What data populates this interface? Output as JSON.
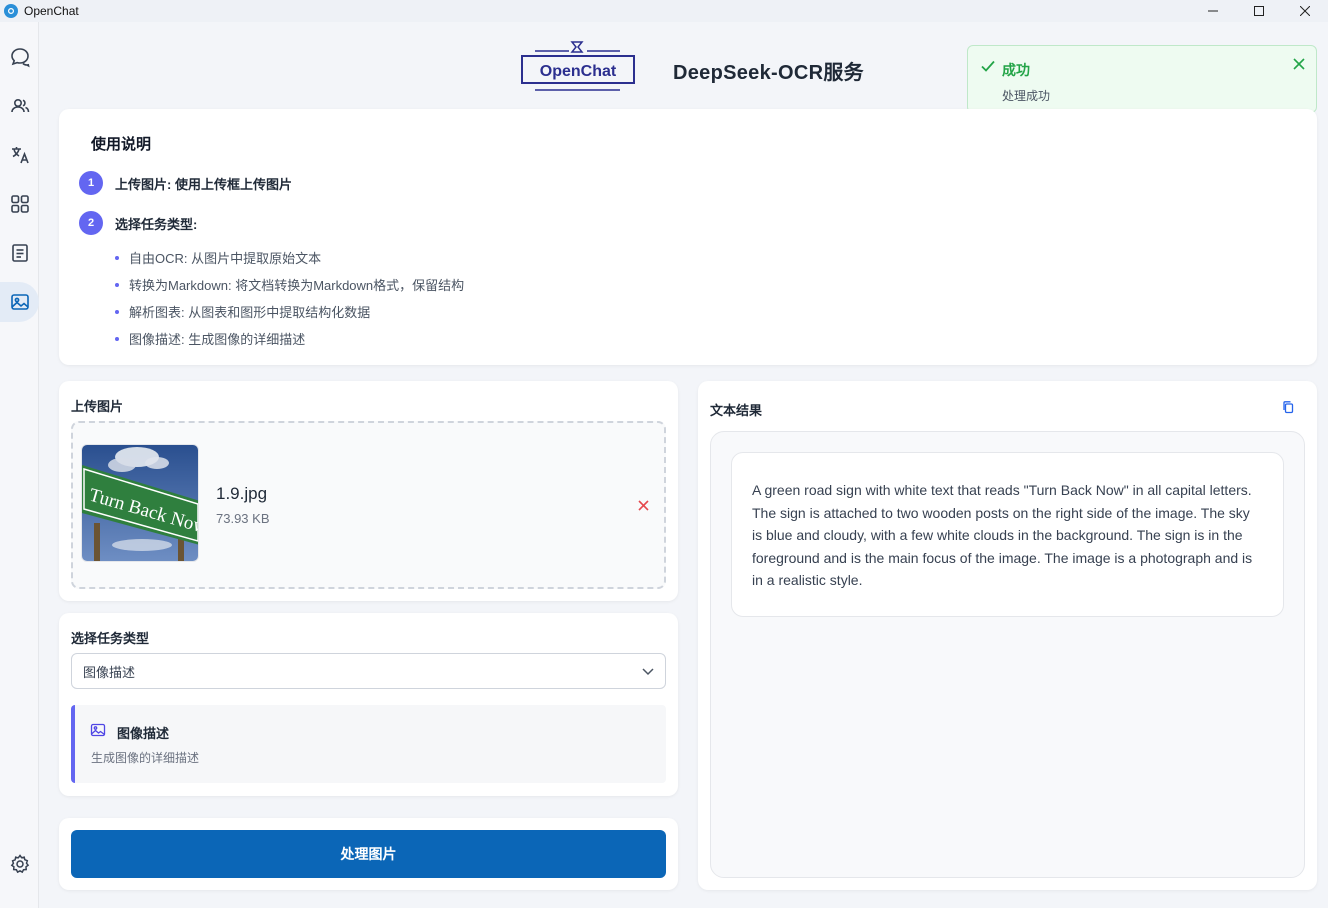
{
  "window": {
    "title": "OpenChat"
  },
  "header": {
    "logo_text": "OpenChat",
    "title": "DeepSeek-OCR服务"
  },
  "toast": {
    "title": "成功",
    "message": "处理成功",
    "color": "#22a447"
  },
  "sidebar": {
    "items": [
      {
        "icon": "chat-icon",
        "active": false
      },
      {
        "icon": "users-icon",
        "active": false
      },
      {
        "icon": "translate-icon",
        "active": false
      },
      {
        "icon": "apps-grid-icon",
        "active": false
      },
      {
        "icon": "document-icon",
        "active": false
      },
      {
        "icon": "image-icon",
        "active": true
      }
    ],
    "bottom_icon": "settings-icon"
  },
  "instructions": {
    "heading": "使用说明",
    "steps": [
      {
        "num": "1",
        "text": "上传图片: 使用上传框上传图片"
      },
      {
        "num": "2",
        "text": "选择任务类型:"
      }
    ],
    "bullets": [
      "自由OCR: 从图片中提取原始文本",
      "转换为Markdown: 将文档转换为Markdown格式，保留结构",
      "解析图表: 从图表和图形中提取结构化数据",
      "图像描述: 生成图像的详细描述"
    ]
  },
  "upload": {
    "label": "上传图片",
    "file_name": "1.9.jpg",
    "file_size": "73.93 KB",
    "thumbnail_text": "Turn Back Now"
  },
  "task": {
    "label": "选择任务类型",
    "selected": "图像描述",
    "desc_title": "图像描述",
    "desc_sub": "生成图像的详细描述"
  },
  "process": {
    "button_label": "处理图片",
    "color": "#0b66b7"
  },
  "result": {
    "label": "文本结果",
    "text": "A green road sign with white text that reads \"Turn Back Now\" in all capital letters. The sign is attached to two wooden posts on the right side of the image. The sky is blue and cloudy, with a few white clouds in the background. The sign is in the foreground and is the main focus of the image. The image is a photograph and is in a realistic style."
  },
  "accent_color": "#6366f1"
}
